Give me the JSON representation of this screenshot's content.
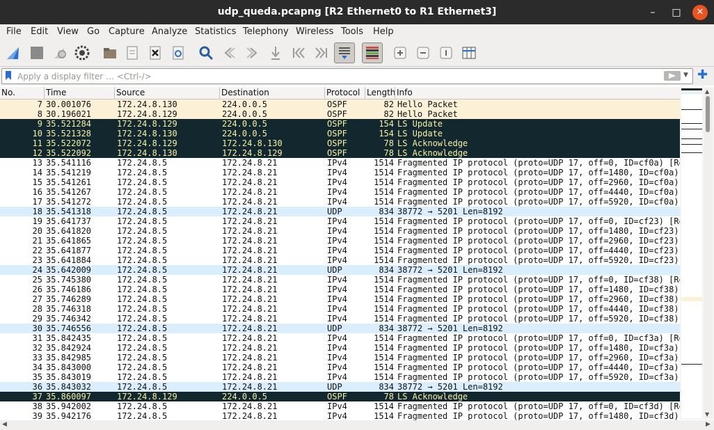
{
  "window": {
    "title": "udp_queda.pcapng [R2 Ethernet0 to R1 Ethernet3]",
    "minimize": "–",
    "maximize": "□",
    "close": "✕"
  },
  "menu": [
    "File",
    "Edit",
    "View",
    "Go",
    "Capture",
    "Analyze",
    "Statistics",
    "Telephony",
    "Wireless",
    "Tools",
    "Help"
  ],
  "filter": {
    "placeholder": "Apply a display filter … <Ctrl-/>"
  },
  "columns": [
    "No.",
    "Time",
    "Source",
    "Destination",
    "Protocol",
    "Length",
    "Info"
  ],
  "colors": {
    "ospf_light": "#fcf0d7",
    "ospf_dark": "#12272e",
    "udp": "#daeeff",
    "ipv4": "#ffffff",
    "dark_text": "#f7f0a3"
  },
  "toolbar_icons": [
    "shark-fin-icon",
    "stop-icon",
    "restart-icon",
    "options-gear-icon",
    "open-folder-icon",
    "file-icon",
    "close-file-icon",
    "reload-icon",
    "find-icon",
    "back-icon",
    "forward-icon",
    "goto-packet-icon",
    "first-packet-icon",
    "last-packet-icon",
    "autoscroll-icon",
    "colorize-icon",
    "zoom-in-icon",
    "zoom-out-icon",
    "normal-size-icon",
    "resize-columns-icon"
  ],
  "packets": [
    {
      "no": "7",
      "time": "30.001076",
      "src": "172.24.8.130",
      "dst": "224.0.0.5",
      "proto": "OSPF",
      "len": "82",
      "info": "Hello Packet",
      "style": "ospf_light"
    },
    {
      "no": "8",
      "time": "30.196021",
      "src": "172.24.8.129",
      "dst": "224.0.0.5",
      "proto": "OSPF",
      "len": "82",
      "info": "Hello Packet",
      "style": "ospf_light"
    },
    {
      "no": "9",
      "time": "35.521284",
      "src": "172.24.8.129",
      "dst": "224.0.0.5",
      "proto": "OSPF",
      "len": "154",
      "info": "LS Update",
      "style": "ospf_dark"
    },
    {
      "no": "10",
      "time": "35.521328",
      "src": "172.24.8.130",
      "dst": "224.0.0.5",
      "proto": "OSPF",
      "len": "154",
      "info": "LS Update",
      "style": "ospf_dark"
    },
    {
      "no": "11",
      "time": "35.522072",
      "src": "172.24.8.129",
      "dst": "172.24.8.130",
      "proto": "OSPF",
      "len": "78",
      "info": "LS Acknowledge",
      "style": "ospf_dark"
    },
    {
      "no": "12",
      "time": "35.522092",
      "src": "172.24.8.130",
      "dst": "172.24.8.129",
      "proto": "OSPF",
      "len": "78",
      "info": "LS Acknowledge",
      "style": "ospf_dark"
    },
    {
      "no": "13",
      "time": "35.541116",
      "src": "172.24.8.5",
      "dst": "172.24.8.21",
      "proto": "IPv4",
      "len": "1514",
      "info": "Fragmented IP protocol (proto=UDP 17, off=0, ID=cf0a) [Re",
      "style": "ipv4"
    },
    {
      "no": "14",
      "time": "35.541219",
      "src": "172.24.8.5",
      "dst": "172.24.8.21",
      "proto": "IPv4",
      "len": "1514",
      "info": "Fragmented IP protocol (proto=UDP 17, off=1480, ID=cf0a)",
      "style": "ipv4"
    },
    {
      "no": "15",
      "time": "35.541261",
      "src": "172.24.8.5",
      "dst": "172.24.8.21",
      "proto": "IPv4",
      "len": "1514",
      "info": "Fragmented IP protocol (proto=UDP 17, off=2960, ID=cf0a)",
      "style": "ipv4"
    },
    {
      "no": "16",
      "time": "35.541267",
      "src": "172.24.8.5",
      "dst": "172.24.8.21",
      "proto": "IPv4",
      "len": "1514",
      "info": "Fragmented IP protocol (proto=UDP 17, off=4440, ID=cf0a)",
      "style": "ipv4"
    },
    {
      "no": "17",
      "time": "35.541272",
      "src": "172.24.8.5",
      "dst": "172.24.8.21",
      "proto": "IPv4",
      "len": "1514",
      "info": "Fragmented IP protocol (proto=UDP 17, off=5920, ID=cf0a)",
      "style": "ipv4"
    },
    {
      "no": "18",
      "time": "35.541318",
      "src": "172.24.8.5",
      "dst": "172.24.8.21",
      "proto": "UDP",
      "len": "834",
      "info": "38772 → 5201 Len=8192",
      "style": "udp"
    },
    {
      "no": "19",
      "time": "35.641737",
      "src": "172.24.8.5",
      "dst": "172.24.8.21",
      "proto": "IPv4",
      "len": "1514",
      "info": "Fragmented IP protocol (proto=UDP 17, off=0, ID=cf23) [Re",
      "style": "ipv4"
    },
    {
      "no": "20",
      "time": "35.641820",
      "src": "172.24.8.5",
      "dst": "172.24.8.21",
      "proto": "IPv4",
      "len": "1514",
      "info": "Fragmented IP protocol (proto=UDP 17, off=1480, ID=cf23)",
      "style": "ipv4"
    },
    {
      "no": "21",
      "time": "35.641865",
      "src": "172.24.8.5",
      "dst": "172.24.8.21",
      "proto": "IPv4",
      "len": "1514",
      "info": "Fragmented IP protocol (proto=UDP 17, off=2960, ID=cf23)",
      "style": "ipv4"
    },
    {
      "no": "22",
      "time": "35.641877",
      "src": "172.24.8.5",
      "dst": "172.24.8.21",
      "proto": "IPv4",
      "len": "1514",
      "info": "Fragmented IP protocol (proto=UDP 17, off=4440, ID=cf23)",
      "style": "ipv4"
    },
    {
      "no": "23",
      "time": "35.641884",
      "src": "172.24.8.5",
      "dst": "172.24.8.21",
      "proto": "IPv4",
      "len": "1514",
      "info": "Fragmented IP protocol (proto=UDP 17, off=5920, ID=cf23)",
      "style": "ipv4"
    },
    {
      "no": "24",
      "time": "35.642009",
      "src": "172.24.8.5",
      "dst": "172.24.8.21",
      "proto": "UDP",
      "len": "834",
      "info": "38772 → 5201 Len=8192",
      "style": "udp"
    },
    {
      "no": "25",
      "time": "35.745380",
      "src": "172.24.8.5",
      "dst": "172.24.8.21",
      "proto": "IPv4",
      "len": "1514",
      "info": "Fragmented IP protocol (proto=UDP 17, off=0, ID=cf38) [Re",
      "style": "ipv4"
    },
    {
      "no": "26",
      "time": "35.746186",
      "src": "172.24.8.5",
      "dst": "172.24.8.21",
      "proto": "IPv4",
      "len": "1514",
      "info": "Fragmented IP protocol (proto=UDP 17, off=1480, ID=cf38)",
      "style": "ipv4"
    },
    {
      "no": "27",
      "time": "35.746289",
      "src": "172.24.8.5",
      "dst": "172.24.8.21",
      "proto": "IPv4",
      "len": "1514",
      "info": "Fragmented IP protocol (proto=UDP 17, off=2960, ID=cf38)",
      "style": "ipv4"
    },
    {
      "no": "28",
      "time": "35.746318",
      "src": "172.24.8.5",
      "dst": "172.24.8.21",
      "proto": "IPv4",
      "len": "1514",
      "info": "Fragmented IP protocol (proto=UDP 17, off=4440, ID=cf38)",
      "style": "ipv4"
    },
    {
      "no": "29",
      "time": "35.746342",
      "src": "172.24.8.5",
      "dst": "172.24.8.21",
      "proto": "IPv4",
      "len": "1514",
      "info": "Fragmented IP protocol (proto=UDP 17, off=5920, ID=cf38)",
      "style": "ipv4"
    },
    {
      "no": "30",
      "time": "35.746556",
      "src": "172.24.8.5",
      "dst": "172.24.8.21",
      "proto": "UDP",
      "len": "834",
      "info": "38772 → 5201 Len=8192",
      "style": "udp"
    },
    {
      "no": "31",
      "time": "35.842435",
      "src": "172.24.8.5",
      "dst": "172.24.8.21",
      "proto": "IPv4",
      "len": "1514",
      "info": "Fragmented IP protocol (proto=UDP 17, off=0, ID=cf3a) [Re",
      "style": "ipv4"
    },
    {
      "no": "32",
      "time": "35.842924",
      "src": "172.24.8.5",
      "dst": "172.24.8.21",
      "proto": "IPv4",
      "len": "1514",
      "info": "Fragmented IP protocol (proto=UDP 17, off=1480, ID=cf3a)",
      "style": "ipv4"
    },
    {
      "no": "33",
      "time": "35.842985",
      "src": "172.24.8.5",
      "dst": "172.24.8.21",
      "proto": "IPv4",
      "len": "1514",
      "info": "Fragmented IP protocol (proto=UDP 17, off=2960, ID=cf3a)",
      "style": "ipv4"
    },
    {
      "no": "34",
      "time": "35.843000",
      "src": "172.24.8.5",
      "dst": "172.24.8.21",
      "proto": "IPv4",
      "len": "1514",
      "info": "Fragmented IP protocol (proto=UDP 17, off=4440, ID=cf3a)",
      "style": "ipv4"
    },
    {
      "no": "35",
      "time": "35.843019",
      "src": "172.24.8.5",
      "dst": "172.24.8.21",
      "proto": "IPv4",
      "len": "1514",
      "info": "Fragmented IP protocol (proto=UDP 17, off=5920, ID=cf3a)",
      "style": "ipv4"
    },
    {
      "no": "36",
      "time": "35.843032",
      "src": "172.24.8.5",
      "dst": "172.24.8.21",
      "proto": "UDP",
      "len": "834",
      "info": "38772 → 5201 Len=8192",
      "style": "udp"
    },
    {
      "no": "37",
      "time": "35.860097",
      "src": "172.24.8.129",
      "dst": "224.0.0.5",
      "proto": "OSPF",
      "len": "78",
      "info": "LS Acknowledge",
      "style": "ospf_dark"
    },
    {
      "no": "38",
      "time": "35.942002",
      "src": "172.24.8.5",
      "dst": "172.24.8.21",
      "proto": "IPv4",
      "len": "1514",
      "info": "Fragmented IP protocol (proto=UDP 17, off=0, ID=cf3d) [Re",
      "style": "ipv4"
    },
    {
      "no": "39",
      "time": "35.942176",
      "src": "172.24.8.5",
      "dst": "172.24.8.21",
      "proto": "IPv4",
      "len": "1514",
      "info": "Fragmented IP protocol (proto=UDP 17, off=1480, ID=cf3d)",
      "style": "ipv4"
    }
  ]
}
